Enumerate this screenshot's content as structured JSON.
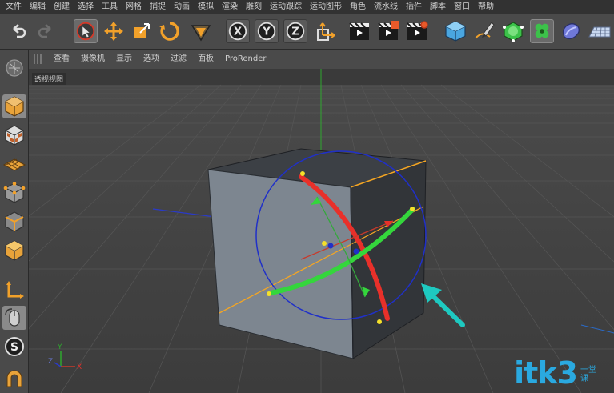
{
  "menubar": {
    "items": [
      "文件",
      "编辑",
      "创建",
      "选择",
      "工具",
      "网格",
      "捕捉",
      "动画",
      "模拟",
      "渲染",
      "雕刻",
      "运动跟踪",
      "运动图形",
      "角色",
      "流水线",
      "插件",
      "脚本",
      "窗口",
      "帮助"
    ]
  },
  "viewmenu": {
    "items": [
      "查看",
      "摄像机",
      "显示",
      "选项",
      "过滤",
      "面板",
      "ProRender"
    ]
  },
  "viewport": {
    "label": "透视视图",
    "axis_x": "X",
    "axis_y": "Y",
    "axis_z": "Z"
  },
  "toolbar": {
    "axis_x": "X",
    "axis_y": "Y",
    "axis_z": "Z"
  },
  "watermark": {
    "main": "itk3",
    "sub": "一堂课"
  },
  "colors": {
    "accent_orange": "#f5a623",
    "rot_red": "#e8302a",
    "rot_green": "#34d63c",
    "rot_blue": "#2030c8",
    "arrow_cyan": "#1ec9c0",
    "watermark": "#2aa9e0"
  }
}
